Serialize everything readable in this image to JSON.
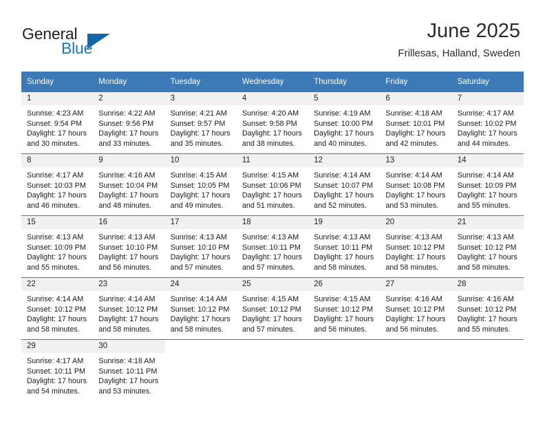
{
  "logo": {
    "primary_text": "General",
    "secondary_text": "Blue",
    "triangle_color": "#1565a8",
    "secondary_color": "#1878bd"
  },
  "header": {
    "title": "June 2025",
    "subtitle": "Frillesas, Halland, Sweden"
  },
  "theme": {
    "header_bg": "#3b79b7",
    "daynum_bg": "#f1f1f1",
    "row_border": "#3b79b7",
    "text": "#1a1a1a"
  },
  "calendar": {
    "weekday_headers": [
      "Sunday",
      "Monday",
      "Tuesday",
      "Wednesday",
      "Thursday",
      "Friday",
      "Saturday"
    ],
    "labels": {
      "sunrise_prefix": "Sunrise:",
      "sunset_prefix": "Sunset:",
      "daylight_prefix": "Daylight:"
    },
    "weeks": [
      [
        {
          "day": "1",
          "sunrise": "Sunrise: 4:23 AM",
          "sunset": "Sunset: 9:54 PM",
          "daylight_line1": "Daylight: 17 hours",
          "daylight_line2": "and 30 minutes."
        },
        {
          "day": "2",
          "sunrise": "Sunrise: 4:22 AM",
          "sunset": "Sunset: 9:56 PM",
          "daylight_line1": "Daylight: 17 hours",
          "daylight_line2": "and 33 minutes."
        },
        {
          "day": "3",
          "sunrise": "Sunrise: 4:21 AM",
          "sunset": "Sunset: 9:57 PM",
          "daylight_line1": "Daylight: 17 hours",
          "daylight_line2": "and 35 minutes."
        },
        {
          "day": "4",
          "sunrise": "Sunrise: 4:20 AM",
          "sunset": "Sunset: 9:58 PM",
          "daylight_line1": "Daylight: 17 hours",
          "daylight_line2": "and 38 minutes."
        },
        {
          "day": "5",
          "sunrise": "Sunrise: 4:19 AM",
          "sunset": "Sunset: 10:00 PM",
          "daylight_line1": "Daylight: 17 hours",
          "daylight_line2": "and 40 minutes."
        },
        {
          "day": "6",
          "sunrise": "Sunrise: 4:18 AM",
          "sunset": "Sunset: 10:01 PM",
          "daylight_line1": "Daylight: 17 hours",
          "daylight_line2": "and 42 minutes."
        },
        {
          "day": "7",
          "sunrise": "Sunrise: 4:17 AM",
          "sunset": "Sunset: 10:02 PM",
          "daylight_line1": "Daylight: 17 hours",
          "daylight_line2": "and 44 minutes."
        }
      ],
      [
        {
          "day": "8",
          "sunrise": "Sunrise: 4:17 AM",
          "sunset": "Sunset: 10:03 PM",
          "daylight_line1": "Daylight: 17 hours",
          "daylight_line2": "and 46 minutes."
        },
        {
          "day": "9",
          "sunrise": "Sunrise: 4:16 AM",
          "sunset": "Sunset: 10:04 PM",
          "daylight_line1": "Daylight: 17 hours",
          "daylight_line2": "and 48 minutes."
        },
        {
          "day": "10",
          "sunrise": "Sunrise: 4:15 AM",
          "sunset": "Sunset: 10:05 PM",
          "daylight_line1": "Daylight: 17 hours",
          "daylight_line2": "and 49 minutes."
        },
        {
          "day": "11",
          "sunrise": "Sunrise: 4:15 AM",
          "sunset": "Sunset: 10:06 PM",
          "daylight_line1": "Daylight: 17 hours",
          "daylight_line2": "and 51 minutes."
        },
        {
          "day": "12",
          "sunrise": "Sunrise: 4:14 AM",
          "sunset": "Sunset: 10:07 PM",
          "daylight_line1": "Daylight: 17 hours",
          "daylight_line2": "and 52 minutes."
        },
        {
          "day": "13",
          "sunrise": "Sunrise: 4:14 AM",
          "sunset": "Sunset: 10:08 PM",
          "daylight_line1": "Daylight: 17 hours",
          "daylight_line2": "and 53 minutes."
        },
        {
          "day": "14",
          "sunrise": "Sunrise: 4:14 AM",
          "sunset": "Sunset: 10:09 PM",
          "daylight_line1": "Daylight: 17 hours",
          "daylight_line2": "and 55 minutes."
        }
      ],
      [
        {
          "day": "15",
          "sunrise": "Sunrise: 4:13 AM",
          "sunset": "Sunset: 10:09 PM",
          "daylight_line1": "Daylight: 17 hours",
          "daylight_line2": "and 55 minutes."
        },
        {
          "day": "16",
          "sunrise": "Sunrise: 4:13 AM",
          "sunset": "Sunset: 10:10 PM",
          "daylight_line1": "Daylight: 17 hours",
          "daylight_line2": "and 56 minutes."
        },
        {
          "day": "17",
          "sunrise": "Sunrise: 4:13 AM",
          "sunset": "Sunset: 10:10 PM",
          "daylight_line1": "Daylight: 17 hours",
          "daylight_line2": "and 57 minutes."
        },
        {
          "day": "18",
          "sunrise": "Sunrise: 4:13 AM",
          "sunset": "Sunset: 10:11 PM",
          "daylight_line1": "Daylight: 17 hours",
          "daylight_line2": "and 57 minutes."
        },
        {
          "day": "19",
          "sunrise": "Sunrise: 4:13 AM",
          "sunset": "Sunset: 10:11 PM",
          "daylight_line1": "Daylight: 17 hours",
          "daylight_line2": "and 58 minutes."
        },
        {
          "day": "20",
          "sunrise": "Sunrise: 4:13 AM",
          "sunset": "Sunset: 10:12 PM",
          "daylight_line1": "Daylight: 17 hours",
          "daylight_line2": "and 58 minutes."
        },
        {
          "day": "21",
          "sunrise": "Sunrise: 4:13 AM",
          "sunset": "Sunset: 10:12 PM",
          "daylight_line1": "Daylight: 17 hours",
          "daylight_line2": "and 58 minutes."
        }
      ],
      [
        {
          "day": "22",
          "sunrise": "Sunrise: 4:14 AM",
          "sunset": "Sunset: 10:12 PM",
          "daylight_line1": "Daylight: 17 hours",
          "daylight_line2": "and 58 minutes."
        },
        {
          "day": "23",
          "sunrise": "Sunrise: 4:14 AM",
          "sunset": "Sunset: 10:12 PM",
          "daylight_line1": "Daylight: 17 hours",
          "daylight_line2": "and 58 minutes."
        },
        {
          "day": "24",
          "sunrise": "Sunrise: 4:14 AM",
          "sunset": "Sunset: 10:12 PM",
          "daylight_line1": "Daylight: 17 hours",
          "daylight_line2": "and 58 minutes."
        },
        {
          "day": "25",
          "sunrise": "Sunrise: 4:15 AM",
          "sunset": "Sunset: 10:12 PM",
          "daylight_line1": "Daylight: 17 hours",
          "daylight_line2": "and 57 minutes."
        },
        {
          "day": "26",
          "sunrise": "Sunrise: 4:15 AM",
          "sunset": "Sunset: 10:12 PM",
          "daylight_line1": "Daylight: 17 hours",
          "daylight_line2": "and 56 minutes."
        },
        {
          "day": "27",
          "sunrise": "Sunrise: 4:16 AM",
          "sunset": "Sunset: 10:12 PM",
          "daylight_line1": "Daylight: 17 hours",
          "daylight_line2": "and 56 minutes."
        },
        {
          "day": "28",
          "sunrise": "Sunrise: 4:16 AM",
          "sunset": "Sunset: 10:12 PM",
          "daylight_line1": "Daylight: 17 hours",
          "daylight_line2": "and 55 minutes."
        }
      ],
      [
        {
          "day": "29",
          "sunrise": "Sunrise: 4:17 AM",
          "sunset": "Sunset: 10:11 PM",
          "daylight_line1": "Daylight: 17 hours",
          "daylight_line2": "and 54 minutes."
        },
        {
          "day": "30",
          "sunrise": "Sunrise: 4:18 AM",
          "sunset": "Sunset: 10:11 PM",
          "daylight_line1": "Daylight: 17 hours",
          "daylight_line2": "and 53 minutes."
        },
        {
          "day": "",
          "sunrise": "",
          "sunset": "",
          "daylight_line1": "",
          "daylight_line2": ""
        },
        {
          "day": "",
          "sunrise": "",
          "sunset": "",
          "daylight_line1": "",
          "daylight_line2": ""
        },
        {
          "day": "",
          "sunrise": "",
          "sunset": "",
          "daylight_line1": "",
          "daylight_line2": ""
        },
        {
          "day": "",
          "sunrise": "",
          "sunset": "",
          "daylight_line1": "",
          "daylight_line2": ""
        },
        {
          "day": "",
          "sunrise": "",
          "sunset": "",
          "daylight_line1": "",
          "daylight_line2": ""
        }
      ]
    ]
  }
}
